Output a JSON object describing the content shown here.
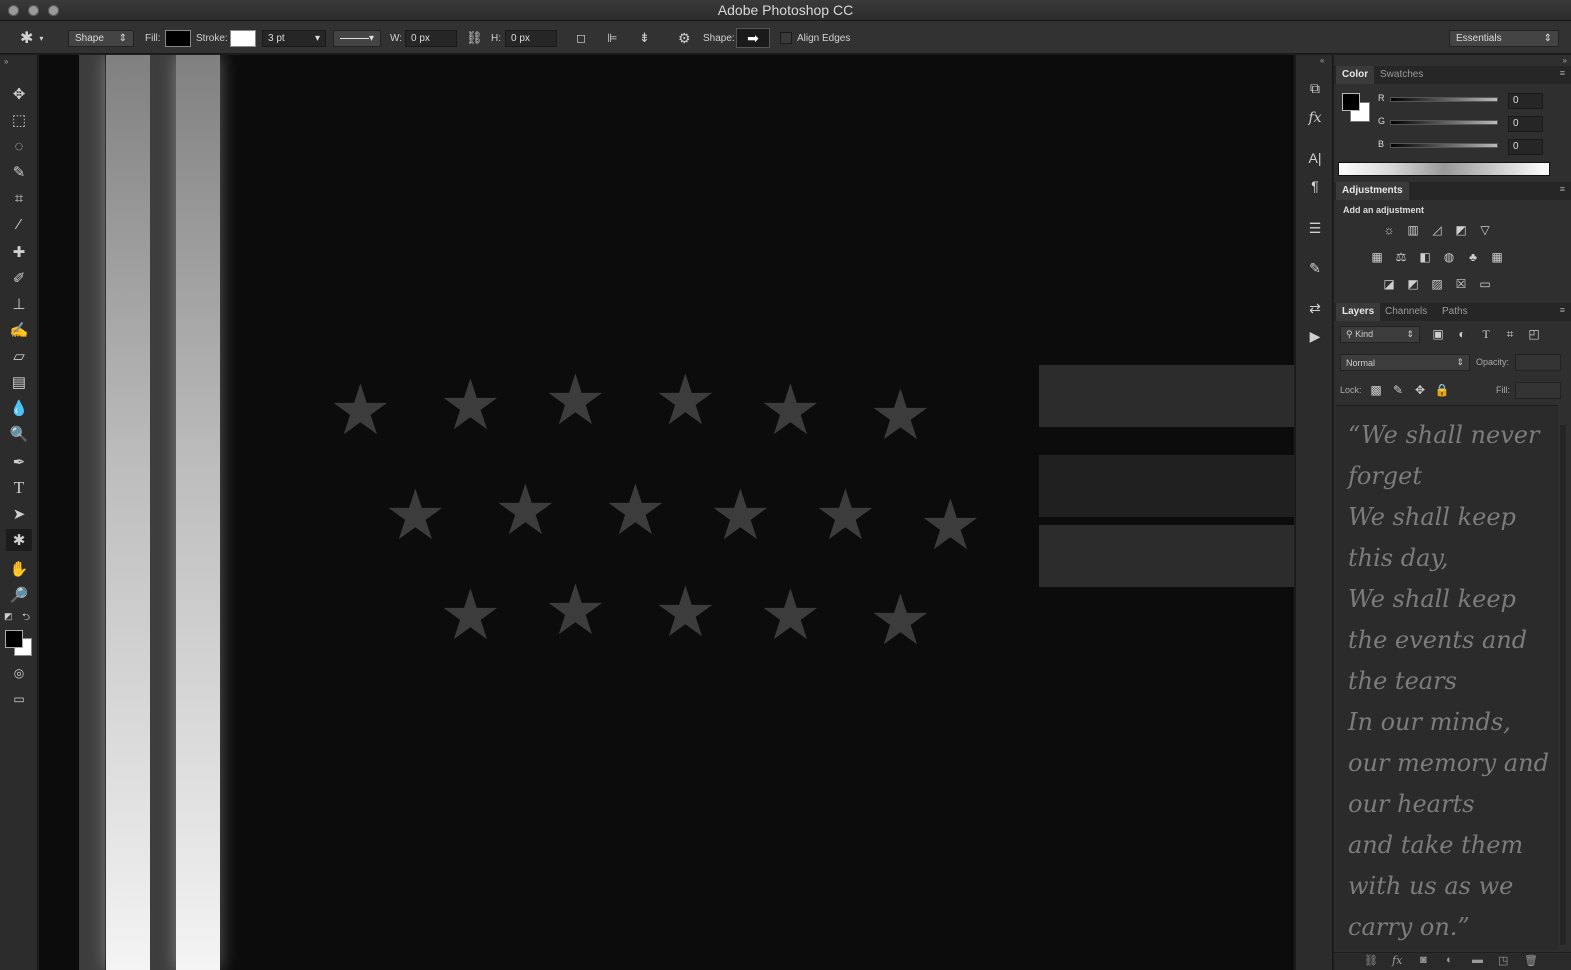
{
  "window": {
    "title": "Adobe Photoshop CC"
  },
  "options_bar": {
    "mode": "Shape",
    "fill_label": "Fill:",
    "stroke_label": "Stroke:",
    "stroke_width": "3 pt",
    "w_label": "W:",
    "w_value": "0 px",
    "h_label": "H:",
    "h_value": "0 px",
    "shape_label": "Shape:",
    "align_edges": "Align Edges",
    "workspace": "Essentials"
  },
  "panels": {
    "color": {
      "tabs": [
        "Color",
        "Swatches"
      ],
      "r_label": "R",
      "g_label": "G",
      "b_label": "B",
      "r_value": "0",
      "g_value": "0",
      "b_value": "0"
    },
    "adjustments": {
      "tab": "Adjustments",
      "heading": "Add an adjustment"
    },
    "layers": {
      "tabs": [
        "Layers",
        "Channels",
        "Paths"
      ],
      "filter": "Kind",
      "blend_mode": "Normal",
      "opacity_label": "Opacity:",
      "lock_label": "Lock:",
      "fill_label": "Fill:"
    }
  },
  "quote": {
    "lines": [
      "“We shall never",
      "forget",
      "We shall keep",
      "this day,",
      "We shall keep",
      "the events and",
      "the tears",
      "In our minds,",
      "our memory and",
      "our hearts",
      "and take them",
      "with us as we",
      "carry on.”"
    ]
  },
  "colors": {
    "canvas": "#0c0c0c",
    "panel": "#2f2f2f",
    "chrome": "#323232"
  }
}
